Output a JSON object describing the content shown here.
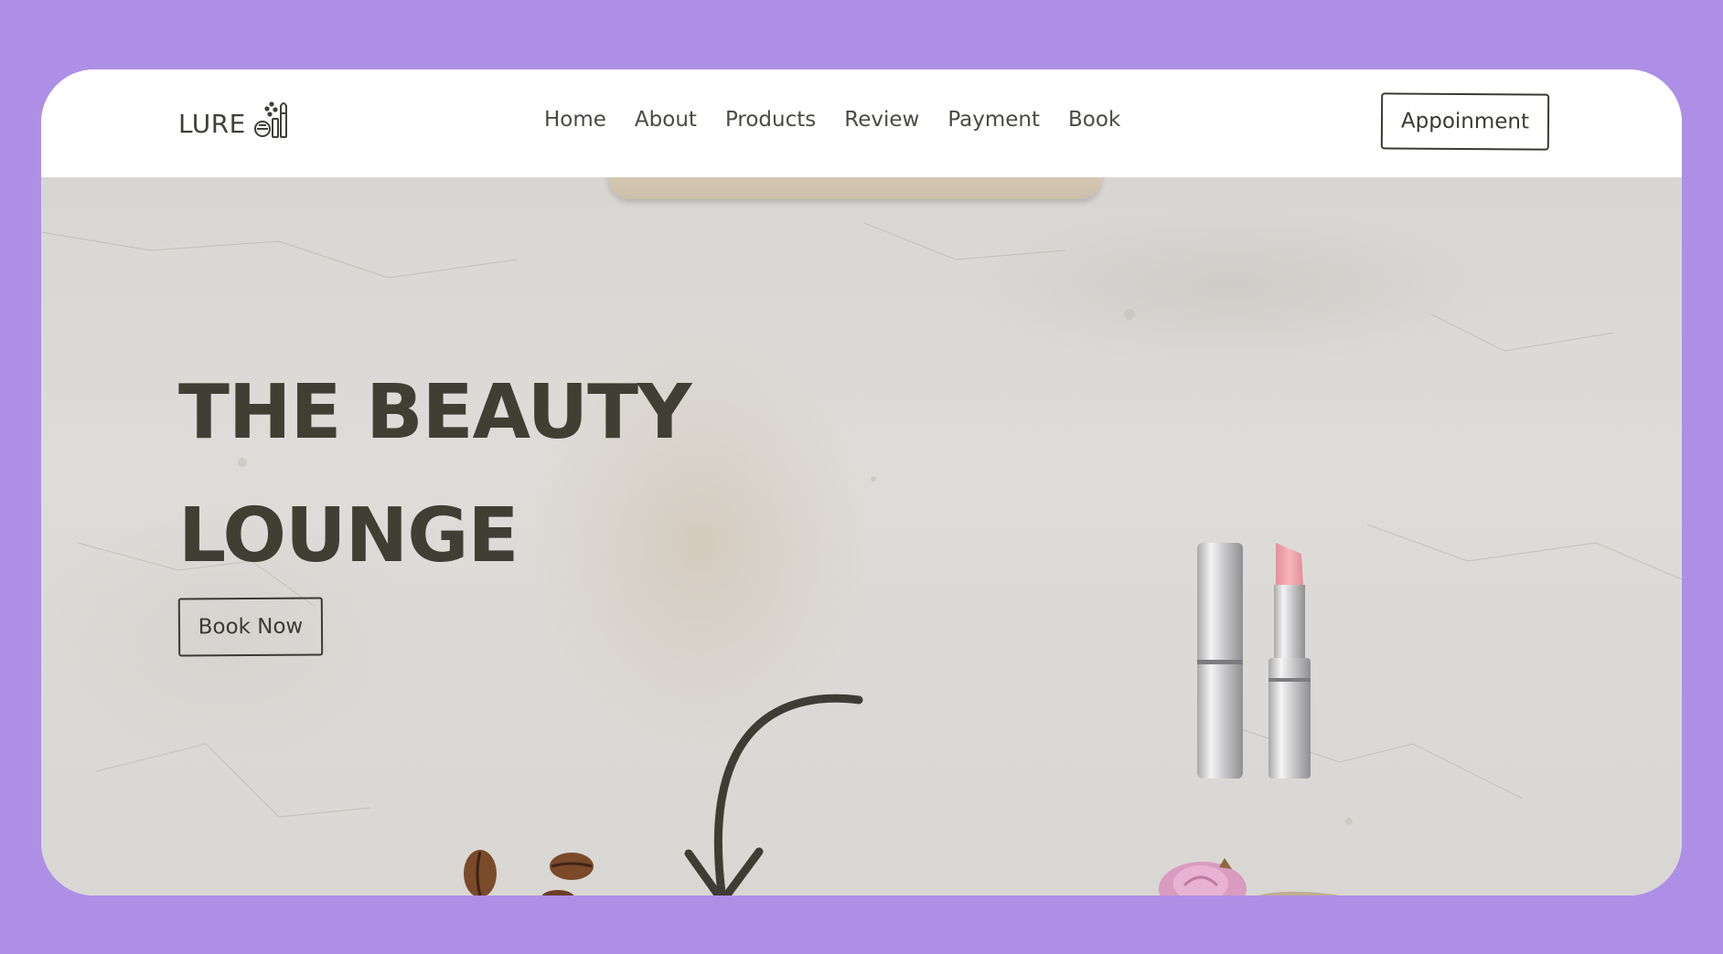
{
  "nav": {
    "brand": "LURE",
    "brand_icon": "makeup-brushes-icon",
    "links": [
      "Home",
      "About",
      "Products",
      "Review",
      "Payment",
      "Book"
    ],
    "cta": "Appoinment"
  },
  "hero": {
    "title_line1": "THE BEAUTY",
    "title_line2": "LOUNGE",
    "cta": "Book Now"
  },
  "colors": {
    "background": "#ae8fe6",
    "text_dark": "#3f3f33",
    "lipstick_pink": "#f0a7ad"
  }
}
